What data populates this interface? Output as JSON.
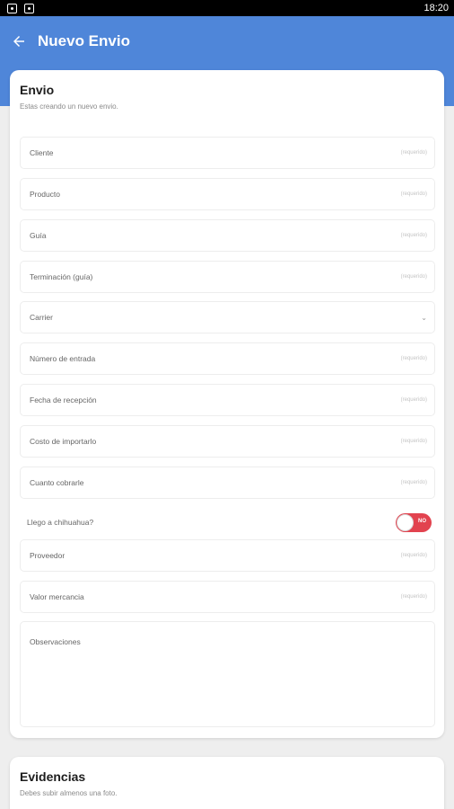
{
  "status_bar": {
    "time": "18:20"
  },
  "header": {
    "title": "Nuevo Envio"
  },
  "envio": {
    "title": "Envio",
    "subtitle": "Estas creando un nuevo envio.",
    "fields": [
      {
        "label": "Cliente",
        "hint": "(requerido)"
      },
      {
        "label": "Producto",
        "hint": "(requerido)"
      },
      {
        "label": "Guía",
        "hint": "(requerido)"
      },
      {
        "label": "Terminación (guía)",
        "hint": "(requerido)"
      },
      {
        "label": "Carrier"
      },
      {
        "label": "Número de entrada",
        "hint": "(requerido)"
      },
      {
        "label": "Fecha de recepción",
        "hint": "(requerido)"
      },
      {
        "label": "Costo de importarlo",
        "hint": "(requerido)"
      },
      {
        "label": "Cuanto cobrarle",
        "hint": "(requerido)"
      }
    ],
    "toggle": {
      "label": "Llego a chihuahua?",
      "state_text": "NO",
      "on": false
    },
    "fields_after": [
      {
        "label": "Proveedor",
        "hint": "(requerido)"
      },
      {
        "label": "Valor mercancia",
        "hint": "(requerido)"
      }
    ],
    "observaciones": {
      "label": "Observaciones"
    }
  },
  "evidencias": {
    "title": "Evidencias",
    "subtitle": "Debes subir almenos una foto."
  },
  "colors": {
    "header": "#4f86d9",
    "toggle_off": "#e2434f",
    "background": "#eeeeee"
  }
}
